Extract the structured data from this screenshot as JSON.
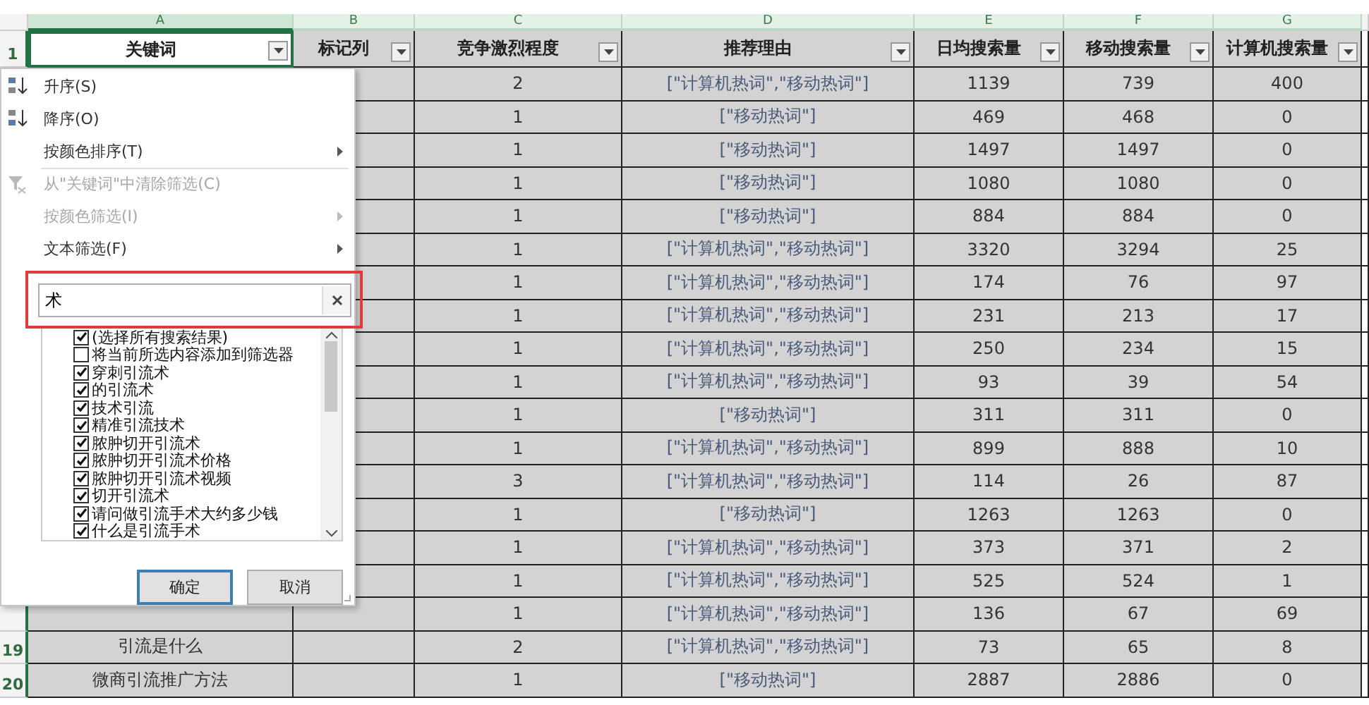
{
  "columns": [
    {
      "letter": "A",
      "header": "关键词",
      "selected": true
    },
    {
      "letter": "B",
      "header": "标记列",
      "selected": false
    },
    {
      "letter": "C",
      "header": "竞争激烈程度",
      "selected": false
    },
    {
      "letter": "D",
      "header": "推荐理由",
      "selected": false
    },
    {
      "letter": "E",
      "header": "日均搜索量",
      "selected": false
    },
    {
      "letter": "F",
      "header": "移动搜索量",
      "selected": false
    },
    {
      "letter": "G",
      "header": "计算机搜索量",
      "selected": false
    }
  ],
  "header_row_number": "1",
  "rows": [
    {
      "cells": [
        "2",
        "[\"计算机热词\",\"移动热词\"]",
        "1139",
        "739",
        "400"
      ]
    },
    {
      "cells": [
        "1",
        "[\"移动热词\"]",
        "469",
        "468",
        "0"
      ]
    },
    {
      "cells": [
        "1",
        "[\"移动热词\"]",
        "1497",
        "1497",
        "0"
      ]
    },
    {
      "cells": [
        "1",
        "[\"移动热词\"]",
        "1080",
        "1080",
        "0"
      ]
    },
    {
      "cells": [
        "1",
        "[\"移动热词\"]",
        "884",
        "884",
        "0"
      ]
    },
    {
      "cells": [
        "1",
        "[\"计算机热词\",\"移动热词\"]",
        "3320",
        "3294",
        "25"
      ]
    },
    {
      "cells": [
        "1",
        "[\"计算机热词\",\"移动热词\"]",
        "174",
        "76",
        "97"
      ]
    },
    {
      "cells": [
        "1",
        "[\"计算机热词\",\"移动热词\"]",
        "231",
        "213",
        "17"
      ]
    },
    {
      "cells": [
        "1",
        "[\"计算机热词\",\"移动热词\"]",
        "250",
        "234",
        "15"
      ]
    },
    {
      "cells": [
        "1",
        "[\"计算机热词\",\"移动热词\"]",
        "93",
        "39",
        "54"
      ]
    },
    {
      "cells": [
        "1",
        "[\"移动热词\"]",
        "311",
        "311",
        "0"
      ]
    },
    {
      "cells": [
        "1",
        "[\"计算机热词\",\"移动热词\"]",
        "899",
        "888",
        "10"
      ]
    },
    {
      "cells": [
        "3",
        "[\"计算机热词\",\"移动热词\"]",
        "114",
        "26",
        "87"
      ]
    },
    {
      "cells": [
        "1",
        "[\"移动热词\"]",
        "1263",
        "1263",
        "0"
      ]
    },
    {
      "cells": [
        "1",
        "[\"计算机热词\",\"移动热词\"]",
        "373",
        "371",
        "2"
      ]
    },
    {
      "cells": [
        "1",
        "[\"计算机热词\",\"移动热词\"]",
        "525",
        "524",
        "1"
      ]
    },
    {
      "cells": [
        "1",
        "[\"计算机热词\",\"移动热词\"]",
        "136",
        "67",
        "69"
      ]
    },
    {
      "number": "19",
      "keyword": "引流是什么",
      "cells": [
        "2",
        "[\"计算机热词\",\"移动热词\"]",
        "73",
        "65",
        "8"
      ]
    },
    {
      "number": "20",
      "keyword": "微商引流推广方法",
      "cells": [
        "1",
        "[\"移动热词\"]",
        "2887",
        "2886",
        "0"
      ]
    }
  ],
  "filter_menu": {
    "items": [
      {
        "label": "升序(S)",
        "kind": "sort_asc",
        "disabled": false,
        "submenu": false,
        "separator_before": false
      },
      {
        "label": "降序(O)",
        "kind": "sort_desc",
        "disabled": false,
        "submenu": false,
        "separator_before": false
      },
      {
        "label": "按颜色排序(T)",
        "kind": "plain",
        "disabled": false,
        "submenu": true,
        "separator_before": false
      },
      {
        "label": "从\"关键词\"中清除筛选(C)",
        "kind": "clear_filter",
        "disabled": true,
        "submenu": false,
        "separator_before": true
      },
      {
        "label": "按颜色筛选(I)",
        "kind": "plain",
        "disabled": true,
        "submenu": true,
        "separator_before": false
      },
      {
        "label": "文本筛选(F)",
        "kind": "plain",
        "disabled": false,
        "submenu": true,
        "separator_before": false
      }
    ],
    "search": {
      "value": "术"
    },
    "list": [
      {
        "label": "(选择所有搜索结果)",
        "checked": true
      },
      {
        "label": "将当前所选内容添加到筛选器",
        "checked": false
      },
      {
        "label": "穿刺引流术",
        "checked": true
      },
      {
        "label": "的引流术",
        "checked": true
      },
      {
        "label": "技术引流",
        "checked": true
      },
      {
        "label": "精准引流技术",
        "checked": true
      },
      {
        "label": "脓肿切开引流术",
        "checked": true
      },
      {
        "label": "脓肿切开引流术价格",
        "checked": true
      },
      {
        "label": "脓肿切开引流术视频",
        "checked": true
      },
      {
        "label": "切开引流术",
        "checked": true
      },
      {
        "label": "请问做引流手术大约多少钱",
        "checked": true
      },
      {
        "label": "什么是引流手术",
        "checked": true
      }
    ],
    "buttons": [
      {
        "label": "确定",
        "focused": true
      },
      {
        "label": "取消",
        "focused": false
      }
    ]
  }
}
